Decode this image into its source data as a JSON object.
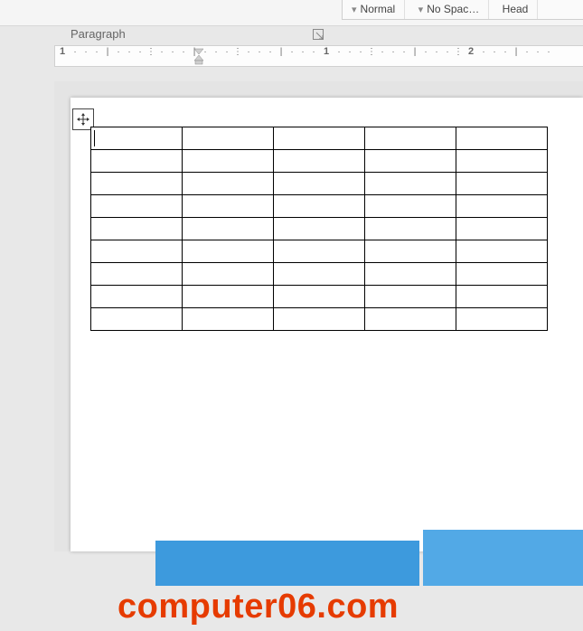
{
  "ribbon": {
    "paragraph_label": "Paragraph",
    "styles": [
      {
        "label": "Normal",
        "selected": true
      },
      {
        "label": "No Spac…",
        "selected": false
      },
      {
        "label": "Head",
        "selected": false
      }
    ]
  },
  "ruler": {
    "marks": [
      "1",
      "·",
      "·",
      "·",
      "|",
      "·",
      "·",
      "·",
      "⋮",
      "·",
      "·",
      "·",
      "|",
      "·",
      "·",
      "·",
      "⋮",
      "·",
      "·",
      "·",
      "|",
      "·",
      "·",
      "·",
      "1",
      "·",
      "·",
      "·",
      "⋮",
      "·",
      "·",
      "·",
      "|",
      "·",
      "·",
      "·",
      "⋮",
      "2",
      "·",
      "·",
      "·",
      "|",
      "·",
      "·",
      "·"
    ]
  },
  "table": {
    "rows": 9,
    "cols": 5
  },
  "watermark": {
    "text": "computer06.com"
  }
}
